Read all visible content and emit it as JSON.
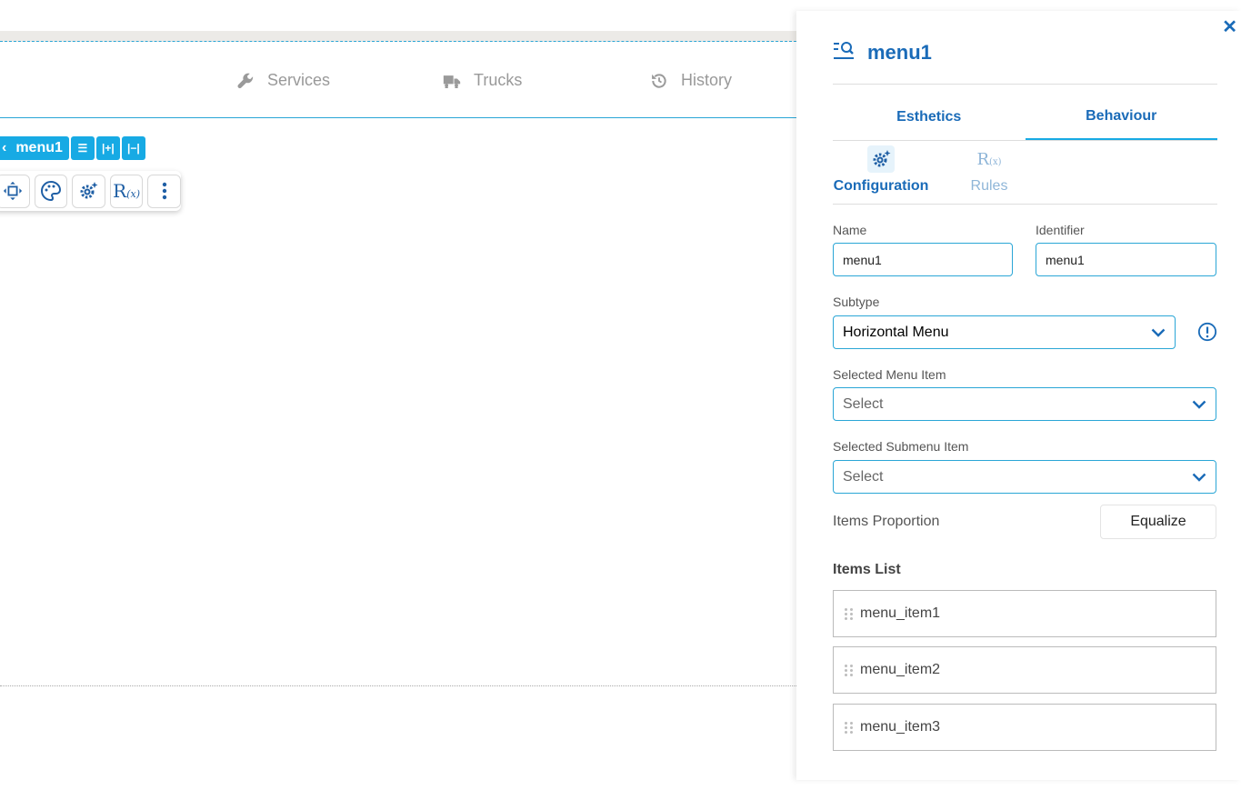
{
  "canvas": {
    "menu_items": [
      {
        "label": "Services",
        "icon": "wrench-icon"
      },
      {
        "label": "Trucks",
        "icon": "truck-icon"
      },
      {
        "label": "History",
        "icon": "history-icon"
      }
    ],
    "component_tag": {
      "label": "menu1"
    }
  },
  "panel": {
    "title": "menu1",
    "tabs": [
      {
        "label": "Esthetics",
        "active": false
      },
      {
        "label": "Behaviour",
        "active": true
      }
    ],
    "subtabs": [
      {
        "label": "Configuration",
        "active": true
      },
      {
        "label": "Rules",
        "active": false
      }
    ],
    "fields": {
      "name_label": "Name",
      "name_value": "menu1",
      "identifier_label": "Identifier",
      "identifier_value": "menu1",
      "subtype_label": "Subtype",
      "subtype_value": "Horizontal Menu",
      "selected_menu_item_label": "Selected Menu Item",
      "selected_menu_item_value": "Select",
      "selected_submenu_item_label": "Selected Submenu Item",
      "selected_submenu_item_value": "Select",
      "items_proportion_label": "Items Proportion",
      "equalize_label": "Equalize"
    },
    "items_list": {
      "title": "Items List",
      "items": [
        "menu_item1",
        "menu_item2",
        "menu_item3"
      ]
    }
  },
  "colors": {
    "accent": "#17aae4",
    "primary_text": "#1a6bb8"
  }
}
